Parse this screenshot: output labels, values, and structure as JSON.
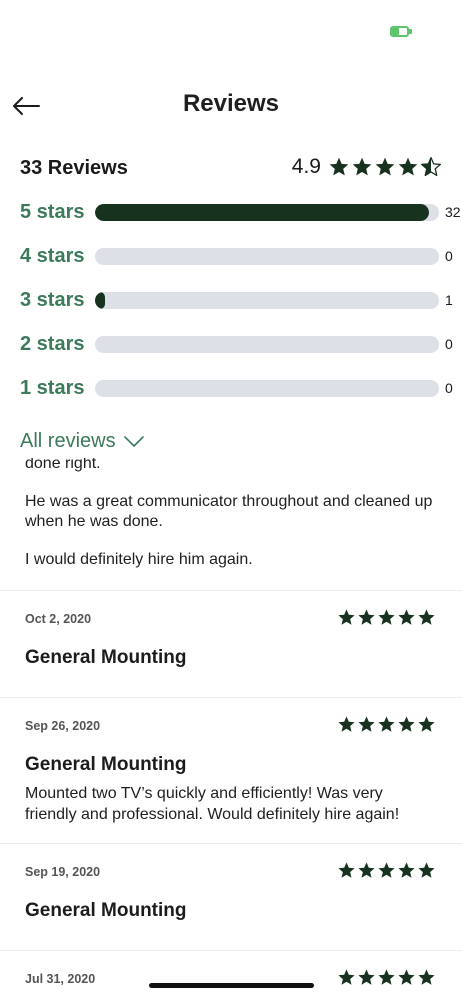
{
  "header": {
    "title": "Reviews"
  },
  "summary": {
    "count_label": "33 Reviews",
    "rating": "4.9"
  },
  "distribution": [
    {
      "label": "5 stars",
      "count": "32",
      "fraction": 0.97
    },
    {
      "label": "4 stars",
      "count": "0",
      "fraction": 0
    },
    {
      "label": "3 stars",
      "count": "1",
      "fraction": 0.03
    },
    {
      "label": "2 stars",
      "count": "0",
      "fraction": 0
    },
    {
      "label": "1 stars",
      "count": "0",
      "fraction": 0
    }
  ],
  "filter": {
    "label": "All reviews"
  },
  "partial_review": {
    "lines": [
      "done right.",
      "He was a great communicator throughout and cleaned up when he was done.",
      "I would definitely hire him again."
    ]
  },
  "reviews": [
    {
      "date": "Oct 2, 2020",
      "title": "General Mounting",
      "body": "",
      "stars": 5
    },
    {
      "date": "Sep 26, 2020",
      "title": "General Mounting",
      "body": "Mounted two TV’s quickly and efficiently! Was very friendly and professional. Would definitely hire again!",
      "stars": 5
    },
    {
      "date": "Sep 19, 2020",
      "title": "General Mounting",
      "body": "",
      "stars": 5
    },
    {
      "date": "Jul 31, 2020",
      "title": "",
      "body": "",
      "stars": 5
    }
  ],
  "colors": {
    "accent": "#3c7a5a",
    "bar_fill": "#173320",
    "bar_track": "#dde0e6",
    "star": "#173320"
  }
}
